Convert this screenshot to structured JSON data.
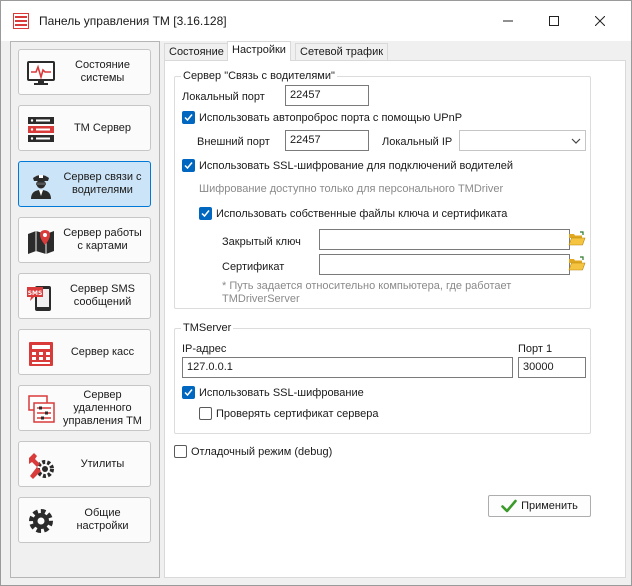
{
  "window": {
    "title": "Панель управления ТМ [3.16.128]"
  },
  "nav": {
    "items": [
      {
        "label": "Состояние системы",
        "icon": "monitor-heartbeat-icon"
      },
      {
        "label": "ТМ Сервер",
        "icon": "server-rack-icon"
      },
      {
        "label": "Сервер связи с водителями",
        "icon": "driver-icon"
      },
      {
        "label": "Сервер работы с картами",
        "icon": "map-pin-icon"
      },
      {
        "label": "Сервер SMS сообщений",
        "icon": "sms-phone-icon"
      },
      {
        "label": "Сервер касс",
        "icon": "cash-register-icon"
      },
      {
        "label": "Сервер удаленного управления ТМ",
        "icon": "remote-control-icon"
      },
      {
        "label": "Утилиты",
        "icon": "wrench-gear-icon"
      },
      {
        "label": "Общие настройки",
        "icon": "gear-icon"
      }
    ],
    "active_index": 2
  },
  "tabs": [
    {
      "label": "Состояние"
    },
    {
      "label": "Настройки"
    },
    {
      "label": "Сетевой трафик"
    }
  ],
  "driver_server": {
    "group_title": "Сервер \"Связь с водителями\"",
    "local_port_label": "Локальный порт",
    "local_port_value": "22457",
    "upnp_label": "Использовать автопроброс порта с помощью UPnP",
    "upnp_checked": true,
    "external_port_label": "Внешний порт",
    "external_port_value": "22457",
    "local_ip_label": "Локальный IP",
    "local_ip_value": "",
    "ssl_label": "Использовать SSL-шифрование для подключений водителей",
    "ssl_checked": true,
    "ssl_note": "Шифрование доступно только для персонального TMDriver",
    "own_keys_label": "Использовать собственные файлы ключа и сертификата",
    "own_keys_checked": true,
    "private_key_label": "Закрытый ключ",
    "private_key_value": "",
    "certificate_label": "Сертификат",
    "certificate_value": "",
    "path_note_line1": "* Путь задается относительно компьютера, где работает",
    "path_note_line2": "TMDriverServer"
  },
  "tmserver": {
    "group_title": "TMServer",
    "ip_label": "IP-адрес",
    "ip_value": "127.0.0.1",
    "port_label": "Порт 1",
    "port_value": "30000",
    "ssl_label": "Использовать SSL-шифрование",
    "ssl_checked": true,
    "verify_label": "Проверять сертификат сервера",
    "verify_checked": false
  },
  "debug": {
    "label": "Отладочный режим (debug)",
    "checked": false
  },
  "apply_button": {
    "label": "Применить"
  },
  "colors": {
    "accent": "#0067c0",
    "active_nav_bg": "#cce4f7",
    "active_nav_border": "#0078d7",
    "icon_red": "#d93a3a",
    "icon_dark": "#2b2b2b"
  }
}
